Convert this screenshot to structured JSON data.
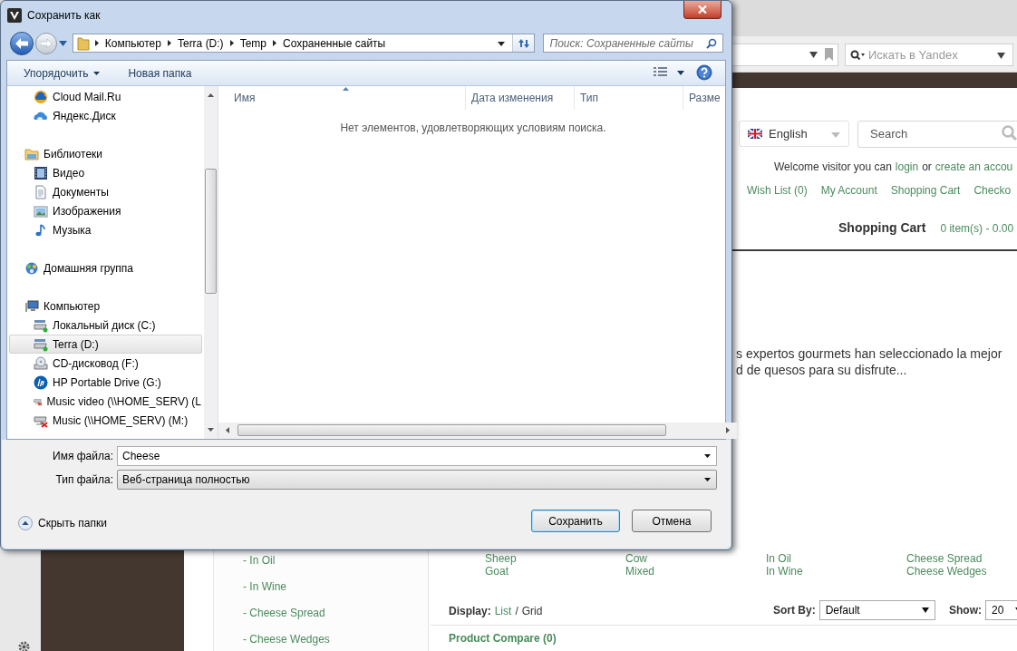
{
  "browser": {
    "yandex_placeholder": "Искать в Yandex",
    "language": "English",
    "site_search_placeholder": "Search",
    "welcome": {
      "text": "Welcome visitor you can",
      "login": "login",
      "or": "or",
      "create": "create an accou"
    },
    "links": [
      "Wish List (0)",
      "My Account",
      "Shopping Cart",
      "Checko"
    ],
    "cart": {
      "title": "Shopping Cart",
      "summary": "0 item(s) - 0.00"
    },
    "intro": [
      "s expertos gourmets han seleccionado la mejor",
      "d de quesos para su disfrute..."
    ],
    "categories": [
      "- In Oil",
      "- In Wine",
      "- Cheese Spread",
      "- Cheese Wedges"
    ],
    "subcategories": [
      [
        "Sheep",
        "Goat"
      ],
      [
        "Cow",
        "Mixed"
      ],
      [
        "In Oil",
        "In Wine"
      ],
      [
        "Cheese Spread",
        "Cheese Wedges"
      ]
    ],
    "display": {
      "label": "Display:",
      "list": "List",
      "separator": "/",
      "grid": "Grid"
    },
    "sort": {
      "label": "Sort By:",
      "value": "Default"
    },
    "show": {
      "label": "Show:",
      "value": "20"
    },
    "compare": "Product Compare (0)"
  },
  "dialog": {
    "title": "Сохранить как",
    "breadcrumb": [
      "Компьютер",
      "Terra (D:)",
      "Temp",
      "Сохраненные сайты"
    ],
    "search_placeholder": "Поиск: Сохраненные сайты",
    "toolbar": [
      "Упорядочить",
      "Новая папка"
    ],
    "nav": [
      {
        "children": [
          {
            "label": "Cloud Mail.Ru",
            "kind": "cloud",
            "selected": false
          },
          {
            "label": "Яндекс.Диск",
            "kind": "yadisk",
            "selected": false
          }
        ]
      },
      {
        "label": "Библиотеки",
        "kind": "library",
        "selected": false,
        "children": [
          {
            "label": "Видео",
            "kind": "video",
            "selected": false
          },
          {
            "label": "Документы",
            "kind": "documents",
            "selected": false
          },
          {
            "label": "Изображения",
            "kind": "pictures",
            "selected": false
          },
          {
            "label": "Музыка",
            "kind": "music",
            "selected": false
          }
        ]
      },
      {
        "label": "Домашняя группа",
        "kind": "homegroup",
        "selected": false
      },
      {
        "label": "Компьютер",
        "kind": "computer",
        "selected": false,
        "children": [
          {
            "label": "Локальный диск (C:)",
            "kind": "drive",
            "selected": false
          },
          {
            "label": "Terra (D:)",
            "kind": "drive",
            "selected": true
          },
          {
            "label": "CD-дисковод (F:)",
            "kind": "cdrom",
            "selected": false
          },
          {
            "label": "HP Portable Drive (G:)",
            "kind": "hp",
            "selected": false
          },
          {
            "label": "Music video (\\\\HOME_SERV) (L",
            "kind": "netoff",
            "selected": false
          },
          {
            "label": "Music (\\\\HOME_SERV) (M:)",
            "kind": "netoff",
            "selected": false
          }
        ]
      }
    ],
    "columns": [
      "Имя",
      "Дата изменения",
      "Тип",
      "Разме"
    ],
    "empty_message": "Нет элементов, удовлетворяющих условиям поиска.",
    "file_name": {
      "label": "Имя файла:",
      "value": "Cheese"
    },
    "file_type": {
      "label": "Тип файла:",
      "value": "Веб-страница полностью"
    },
    "hide_folders": "Скрыть папки",
    "buttons": [
      "Сохранить",
      "Отмена"
    ]
  }
}
